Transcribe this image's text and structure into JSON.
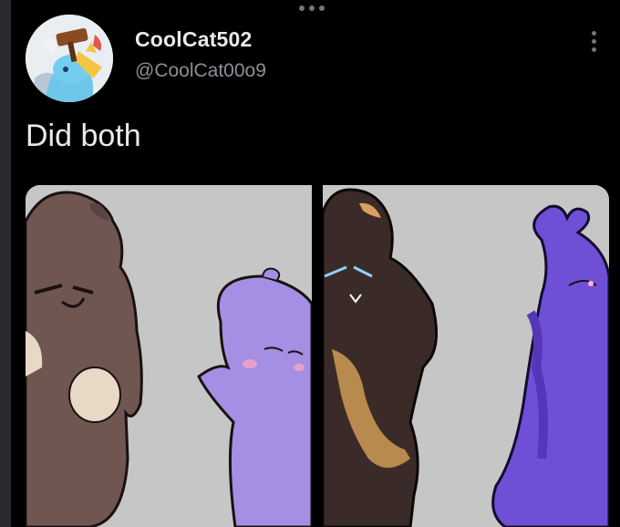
{
  "tweet": {
    "display_name": "CoolCat502",
    "handle": "@CoolCat00o9",
    "text": "Did both",
    "avatar_icon": "avatar",
    "more_icon": "more-options-icon"
  },
  "media": {
    "images": [
      {
        "name": "tweet-image-1"
      },
      {
        "name": "tweet-image-2"
      }
    ]
  },
  "colors": {
    "background": "#000000",
    "text_primary": "#e7e9ea",
    "text_secondary": "#8b9096",
    "image_background": "#c6c6c6"
  }
}
